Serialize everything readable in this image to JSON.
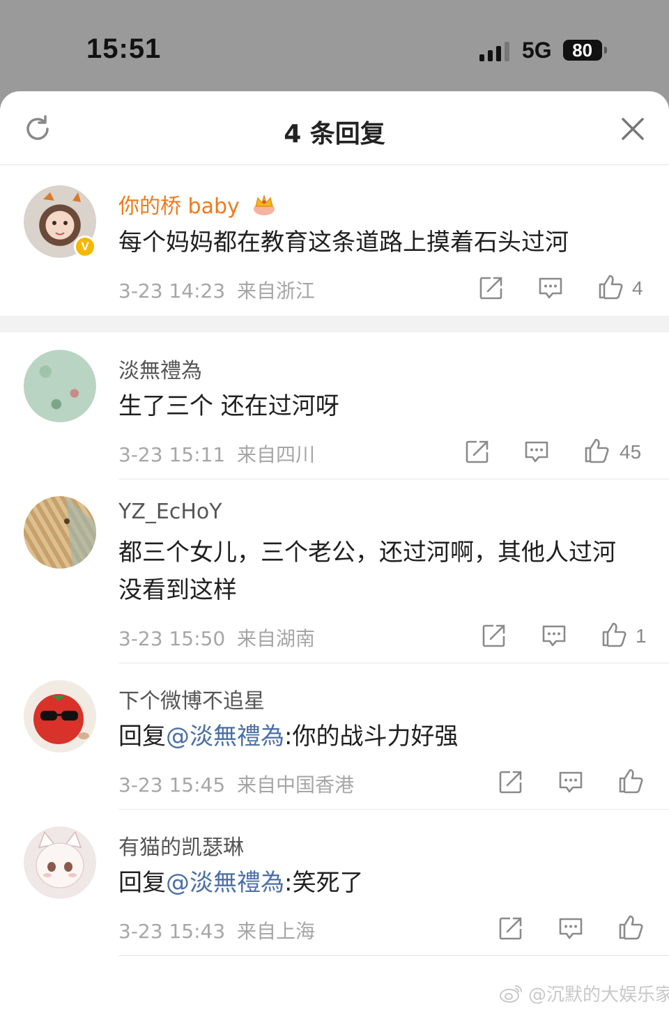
{
  "status_bar": {
    "time": "15:51",
    "network": "5G",
    "battery": "80"
  },
  "header": {
    "title": "4 条回复"
  },
  "main_comment": {
    "username": "你的桥 baby",
    "text": "每个妈妈都在教育这条道路上摸着石头过河",
    "time": "3-23 14:23",
    "location": "来自浙江",
    "likes": "4"
  },
  "replies": [
    {
      "username": "淡無禮為",
      "text": "生了三个 还在过河呀",
      "time": "3-23 15:11",
      "location": "来自四川",
      "likes": "45"
    },
    {
      "username": "YZ_EcHoY",
      "text": "都三个女儿，三个老公，还过河啊，其他人过河没看到这样",
      "time": "3-23 15:50",
      "location": "来自湖南",
      "likes": "1"
    },
    {
      "username": "下个微博不追星",
      "reply_prefix": "回复",
      "mention": "@淡無禮為",
      "text": ":你的战斗力好强",
      "time": "3-23 15:45",
      "location": "来自中国香港",
      "likes": ""
    },
    {
      "username": "有猫的凯瑟琳",
      "reply_prefix": "回复",
      "mention": "@淡無禮為",
      "text": ":笑死了",
      "time": "3-23 15:43",
      "location": "来自上海",
      "likes": ""
    }
  ],
  "watermark": "@沉默的大娱乐家",
  "icons": [
    "refresh-icon",
    "close-icon",
    "share-icon",
    "comment-icon",
    "like-icon",
    "crown-icon",
    "weibo-logo"
  ]
}
